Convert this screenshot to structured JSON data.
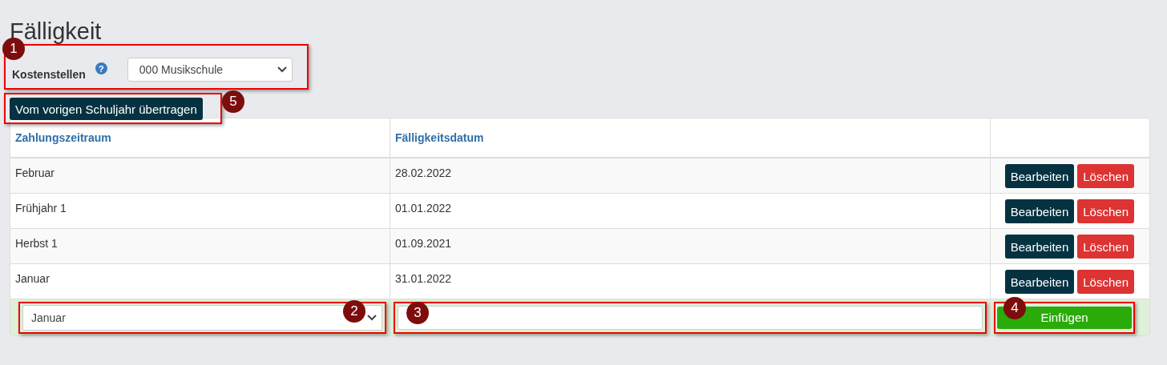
{
  "title": "Fälligkeit",
  "cost_center": {
    "marker": "1",
    "label": "Kostenstellen",
    "help": "?",
    "value": "000 Musikschule"
  },
  "transfer_button": {
    "marker": "5",
    "label": "Vom vorigen Schuljahr übertragen"
  },
  "table": {
    "columns": [
      "Zahlungszeitraum",
      "Fälligkeitsdatum"
    ],
    "rows": [
      {
        "period": "Februar",
        "date": "28.02.2022",
        "edit": "Bearbeiten",
        "delete": "Löschen"
      },
      {
        "period": "Frühjahr 1",
        "date": "01.01.2022",
        "edit": "Bearbeiten",
        "delete": "Löschen"
      },
      {
        "period": "Herbst 1",
        "date": "01.09.2021",
        "edit": "Bearbeiten",
        "delete": "Löschen"
      },
      {
        "period": "Januar",
        "date": "31.01.2022",
        "edit": "Bearbeiten",
        "delete": "Löschen"
      }
    ],
    "new_row": {
      "period": {
        "marker": "2",
        "value": "Januar"
      },
      "date": {
        "marker": "3"
      },
      "insert": {
        "marker": "4",
        "label": "Einfügen"
      }
    }
  }
}
